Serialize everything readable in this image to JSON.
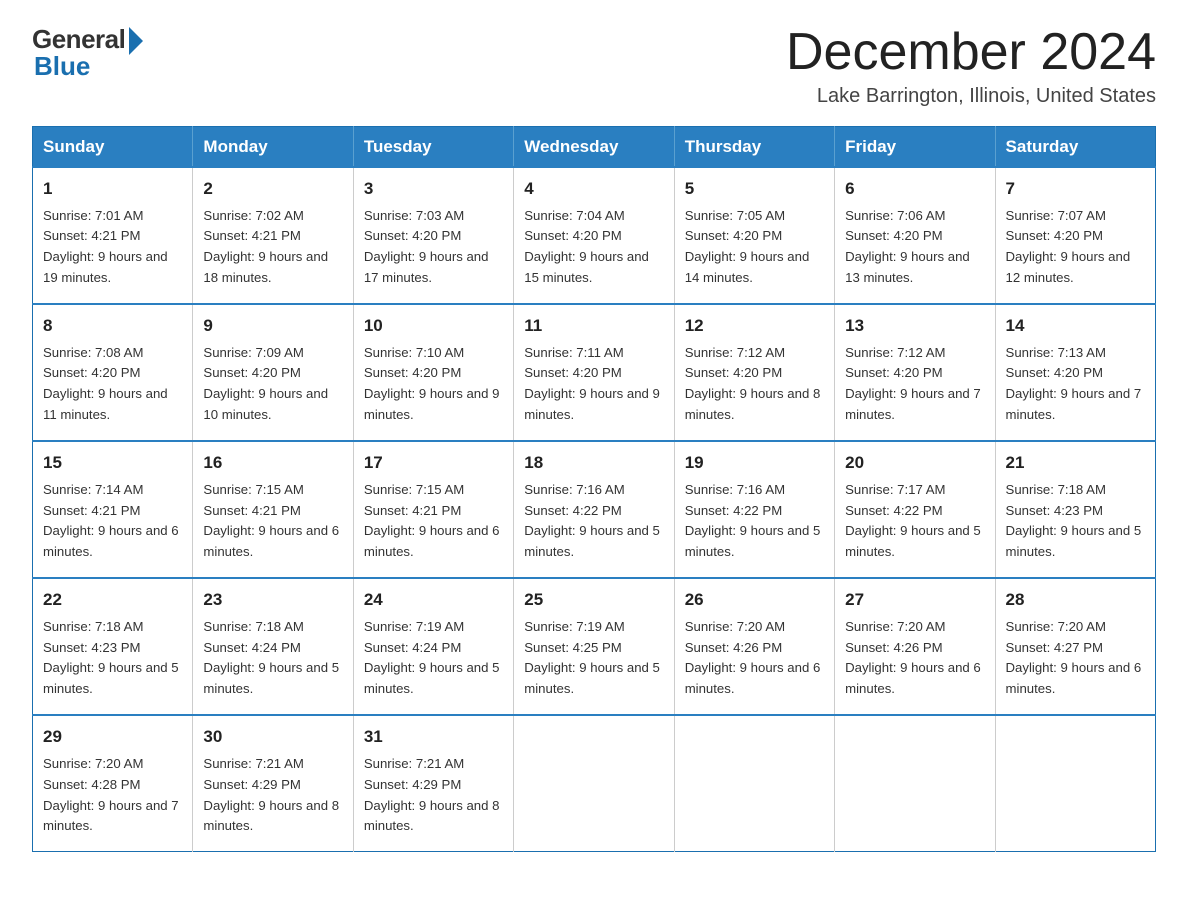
{
  "header": {
    "logo_general": "General",
    "logo_blue": "Blue",
    "month_title": "December 2024",
    "location": "Lake Barrington, Illinois, United States"
  },
  "weekdays": [
    "Sunday",
    "Monday",
    "Tuesday",
    "Wednesday",
    "Thursday",
    "Friday",
    "Saturday"
  ],
  "weeks": [
    [
      {
        "day": "1",
        "sunrise": "7:01 AM",
        "sunset": "4:21 PM",
        "daylight": "9 hours and 19 minutes."
      },
      {
        "day": "2",
        "sunrise": "7:02 AM",
        "sunset": "4:21 PM",
        "daylight": "9 hours and 18 minutes."
      },
      {
        "day": "3",
        "sunrise": "7:03 AM",
        "sunset": "4:20 PM",
        "daylight": "9 hours and 17 minutes."
      },
      {
        "day": "4",
        "sunrise": "7:04 AM",
        "sunset": "4:20 PM",
        "daylight": "9 hours and 15 minutes."
      },
      {
        "day": "5",
        "sunrise": "7:05 AM",
        "sunset": "4:20 PM",
        "daylight": "9 hours and 14 minutes."
      },
      {
        "day": "6",
        "sunrise": "7:06 AM",
        "sunset": "4:20 PM",
        "daylight": "9 hours and 13 minutes."
      },
      {
        "day": "7",
        "sunrise": "7:07 AM",
        "sunset": "4:20 PM",
        "daylight": "9 hours and 12 minutes."
      }
    ],
    [
      {
        "day": "8",
        "sunrise": "7:08 AM",
        "sunset": "4:20 PM",
        "daylight": "9 hours and 11 minutes."
      },
      {
        "day": "9",
        "sunrise": "7:09 AM",
        "sunset": "4:20 PM",
        "daylight": "9 hours and 10 minutes."
      },
      {
        "day": "10",
        "sunrise": "7:10 AM",
        "sunset": "4:20 PM",
        "daylight": "9 hours and 9 minutes."
      },
      {
        "day": "11",
        "sunrise": "7:11 AM",
        "sunset": "4:20 PM",
        "daylight": "9 hours and 9 minutes."
      },
      {
        "day": "12",
        "sunrise": "7:12 AM",
        "sunset": "4:20 PM",
        "daylight": "9 hours and 8 minutes."
      },
      {
        "day": "13",
        "sunrise": "7:12 AM",
        "sunset": "4:20 PM",
        "daylight": "9 hours and 7 minutes."
      },
      {
        "day": "14",
        "sunrise": "7:13 AM",
        "sunset": "4:20 PM",
        "daylight": "9 hours and 7 minutes."
      }
    ],
    [
      {
        "day": "15",
        "sunrise": "7:14 AM",
        "sunset": "4:21 PM",
        "daylight": "9 hours and 6 minutes."
      },
      {
        "day": "16",
        "sunrise": "7:15 AM",
        "sunset": "4:21 PM",
        "daylight": "9 hours and 6 minutes."
      },
      {
        "day": "17",
        "sunrise": "7:15 AM",
        "sunset": "4:21 PM",
        "daylight": "9 hours and 6 minutes."
      },
      {
        "day": "18",
        "sunrise": "7:16 AM",
        "sunset": "4:22 PM",
        "daylight": "9 hours and 5 minutes."
      },
      {
        "day": "19",
        "sunrise": "7:16 AM",
        "sunset": "4:22 PM",
        "daylight": "9 hours and 5 minutes."
      },
      {
        "day": "20",
        "sunrise": "7:17 AM",
        "sunset": "4:22 PM",
        "daylight": "9 hours and 5 minutes."
      },
      {
        "day": "21",
        "sunrise": "7:18 AM",
        "sunset": "4:23 PM",
        "daylight": "9 hours and 5 minutes."
      }
    ],
    [
      {
        "day": "22",
        "sunrise": "7:18 AM",
        "sunset": "4:23 PM",
        "daylight": "9 hours and 5 minutes."
      },
      {
        "day": "23",
        "sunrise": "7:18 AM",
        "sunset": "4:24 PM",
        "daylight": "9 hours and 5 minutes."
      },
      {
        "day": "24",
        "sunrise": "7:19 AM",
        "sunset": "4:24 PM",
        "daylight": "9 hours and 5 minutes."
      },
      {
        "day": "25",
        "sunrise": "7:19 AM",
        "sunset": "4:25 PM",
        "daylight": "9 hours and 5 minutes."
      },
      {
        "day": "26",
        "sunrise": "7:20 AM",
        "sunset": "4:26 PM",
        "daylight": "9 hours and 6 minutes."
      },
      {
        "day": "27",
        "sunrise": "7:20 AM",
        "sunset": "4:26 PM",
        "daylight": "9 hours and 6 minutes."
      },
      {
        "day": "28",
        "sunrise": "7:20 AM",
        "sunset": "4:27 PM",
        "daylight": "9 hours and 6 minutes."
      }
    ],
    [
      {
        "day": "29",
        "sunrise": "7:20 AM",
        "sunset": "4:28 PM",
        "daylight": "9 hours and 7 minutes."
      },
      {
        "day": "30",
        "sunrise": "7:21 AM",
        "sunset": "4:29 PM",
        "daylight": "9 hours and 8 minutes."
      },
      {
        "day": "31",
        "sunrise": "7:21 AM",
        "sunset": "4:29 PM",
        "daylight": "9 hours and 8 minutes."
      },
      null,
      null,
      null,
      null
    ]
  ],
  "labels": {
    "sunrise": "Sunrise: ",
    "sunset": "Sunset: ",
    "daylight": "Daylight: "
  }
}
